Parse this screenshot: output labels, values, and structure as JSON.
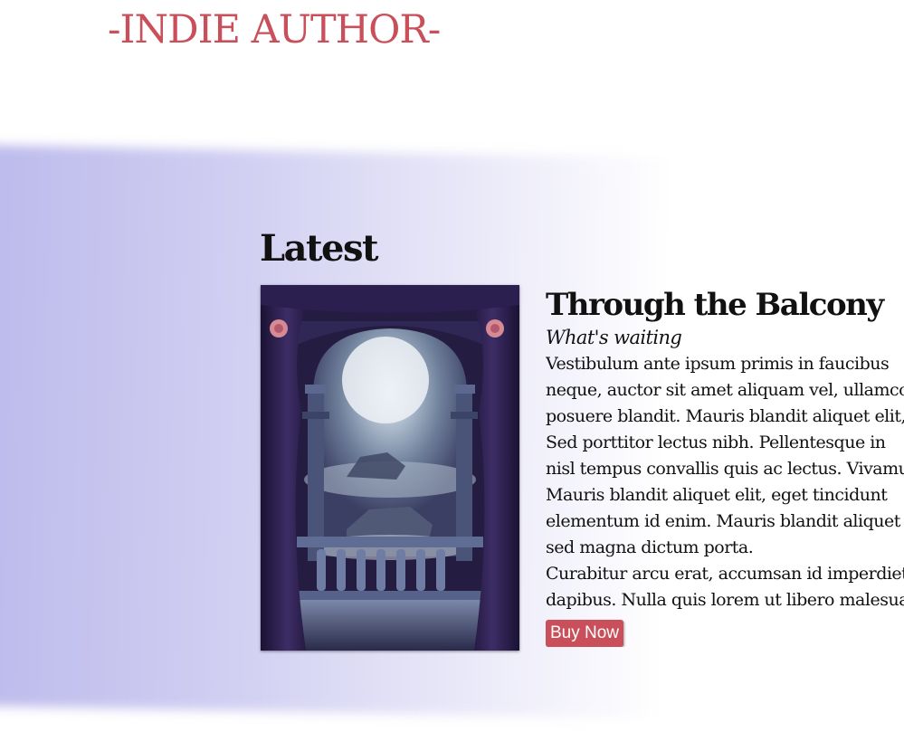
{
  "header": {
    "site_title": "-INDIE AUTHOR-"
  },
  "colors": {
    "accent": "#c9505a",
    "band_start": "#bcbaeb",
    "text": "#111111"
  },
  "latest": {
    "heading": "Latest",
    "book": {
      "cover_alt": "Book cover: moonlit balcony with arches and curtains",
      "title": "Through the Balcony",
      "subtitle": "What's waiting",
      "description_lines": [
        "Vestibulum ante ipsum primis in faucibus",
        "neque, auctor sit amet aliquam vel, ullamcorper",
        "posuere blandit. Mauris blandit aliquet elit,",
        "Sed porttitor lectus nibh. Pellentesque in",
        "nisl tempus convallis quis ac lectus. Vivamus",
        "Mauris blandit aliquet elit, eget tincidunt",
        "elementum id enim. Mauris blandit aliquet",
        "sed magna dictum porta.",
        "Curabitur arcu erat, accumsan id imperdiet",
        "dapibus. Nulla quis lorem ut libero malesuada"
      ],
      "buy_label": "Buy Now"
    }
  }
}
